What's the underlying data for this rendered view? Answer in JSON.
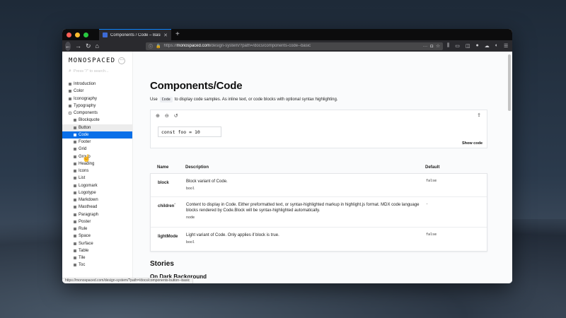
{
  "browser": {
    "tab_title": "Components / Code – Basic · S",
    "tab_close": "✕",
    "new_tab": "+",
    "url_prefix": "https://",
    "url_host": "monospaced.com",
    "url_path": "/design-system/?path=/docs/components-code--basic",
    "status_url": "https://monospaced.com/design-system/?path=/docs/components-button--basic"
  },
  "sidebar": {
    "brand": "MONOSPACED",
    "brand_menu": "···",
    "search_placeholder": "Press \"/\" to search...",
    "items": [
      {
        "label": "Introduction"
      },
      {
        "label": "Color"
      },
      {
        "label": "Iconography"
      },
      {
        "label": "Typography"
      },
      {
        "label": "Components"
      },
      {
        "label": "Blockquote"
      },
      {
        "label": "Button"
      },
      {
        "label": "Code"
      },
      {
        "label": "Footer"
      },
      {
        "label": "Grid"
      },
      {
        "label": "Group"
      },
      {
        "label": "Heading"
      },
      {
        "label": "Icons"
      },
      {
        "label": "List"
      },
      {
        "label": "Logomark"
      },
      {
        "label": "Logotype"
      },
      {
        "label": "Markdown"
      },
      {
        "label": "Masthead"
      },
      {
        "label": "Paragraph"
      },
      {
        "label": "Poster"
      },
      {
        "label": "Rule"
      },
      {
        "label": "Space"
      },
      {
        "label": "Surface"
      },
      {
        "label": "Table"
      },
      {
        "label": "Tile"
      },
      {
        "label": "Toc"
      }
    ]
  },
  "main": {
    "title": "Components/Code",
    "intro_before": "Use",
    "intro_chip": "Code",
    "intro_after": "to display code samples. As inline text, or code blocks with optional syntax highlighting.",
    "demo": {
      "code": "const foo = 10",
      "show_code": "Show code"
    },
    "props": {
      "headers": {
        "name": "Name",
        "description": "Description",
        "default": "Default"
      },
      "rows": [
        {
          "name": "block",
          "required": "",
          "description": "Block variant of Code.",
          "type": "bool",
          "default": "false"
        },
        {
          "name": "children",
          "required": "*",
          "description": "Content to display in Code. Either preformatted text, or syntax-highlighted markup in highlight.js format. MDX code language blocks rendered by Code.Block will be syntax-highlighted automatically.",
          "type": "node",
          "default": "-"
        },
        {
          "name": "lightMode",
          "required": "",
          "description": "Light variant of Code. Only applies if block is true.",
          "type": "bool",
          "default": "false"
        }
      ]
    },
    "stories_title": "Stories",
    "stories_subtitle": "On Dark Background"
  },
  "colors": {
    "active_nav": "#0a6fe8",
    "traffic_red": "#ff5f57",
    "traffic_yellow": "#febc2e",
    "traffic_green": "#28c840"
  }
}
